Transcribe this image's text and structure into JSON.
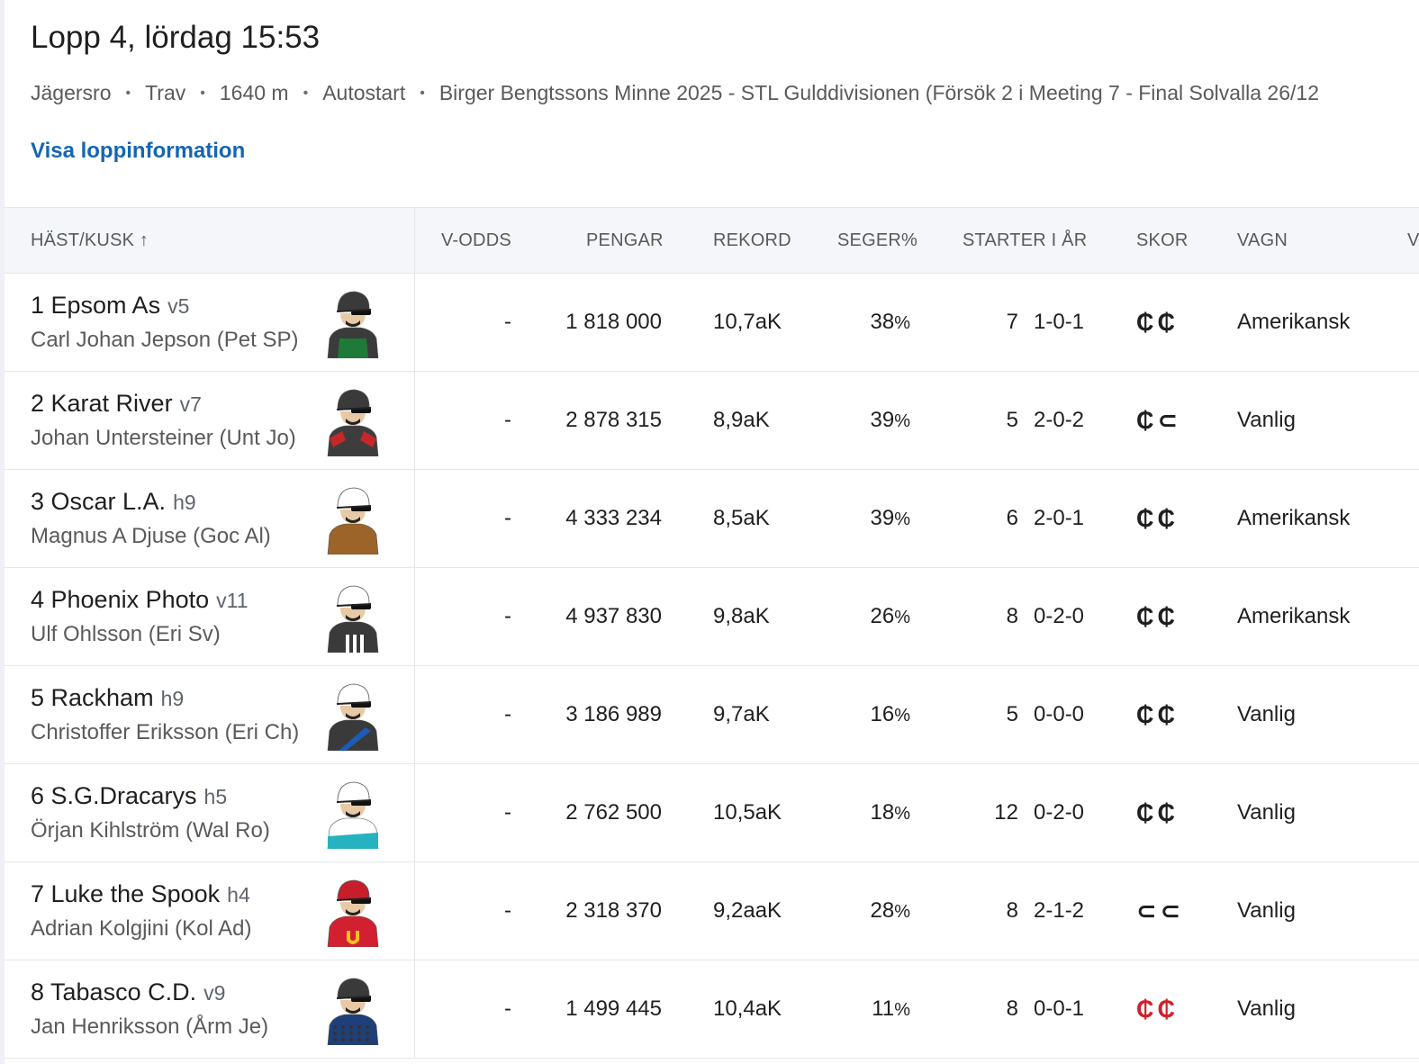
{
  "race": {
    "title": "Lopp 4,  lördag 15:53",
    "track": "Jägersro",
    "type": "Trav",
    "distance": "1640 m",
    "start": "Autostart",
    "name": "Birger Bengtssons Minne 2025 - STL Gulddivisionen (Försök 2 i Meeting 7 - Final Solvalla 26/12",
    "separator": "•",
    "info_link": "Visa loppinformation"
  },
  "columns": {
    "horse_driver": "HÄST/KUSK ↑",
    "vodds": "V-ODDS",
    "money": "PENGAR",
    "record": "REKORD",
    "win_pct": "SEGER%",
    "starts": "STARTER I ÅR",
    "shoes": "SKOR",
    "sulky": "VAGN",
    "more": "V"
  },
  "colors": {
    "link": "#1565b4",
    "shoe_red": "#d0202a",
    "header_bg": "#f4f6f9"
  },
  "rows": [
    {
      "horse": "1 Epsom As",
      "age": "v5",
      "driver": "Carl Johan Jepson (Pet SP)",
      "vodds": "-",
      "money": "1 818 000",
      "record": "10,7aK",
      "win": "38",
      "pct_sign": "%",
      "starts": "7",
      "placings": "1-0-1",
      "shoes": "₵₵",
      "shoes_red": false,
      "sulky": "Amerikansk",
      "silk": {
        "helmet": "#3a3a3a",
        "body": "#3b3b3b",
        "accent": "#1f7a3a",
        "pattern": "vest"
      }
    },
    {
      "horse": "2 Karat River",
      "age": "v7",
      "driver": "Johan Untersteiner (Unt Jo)",
      "vodds": "-",
      "money": "2 878 315",
      "record": "8,9aK",
      "win": "39",
      "pct_sign": "%",
      "starts": "5",
      "placings": "2-0-2",
      "shoes": "₵⊂",
      "shoes_red": false,
      "sulky": "Vanlig",
      "silk": {
        "helmet": "#3a3a3a",
        "body": "#3d3d3d",
        "accent": "#c62828",
        "pattern": "shoulders"
      }
    },
    {
      "horse": "3 Oscar L.A.",
      "age": "h9",
      "driver": "Magnus A Djuse (Goc Al)",
      "vodds": "-",
      "money": "4 333 234",
      "record": "8,5aK",
      "win": "39",
      "pct_sign": "%",
      "starts": "6",
      "placings": "2-0-1",
      "shoes": "₵₵",
      "shoes_red": false,
      "sulky": "Amerikansk",
      "silk": {
        "helmet": "#ffffff",
        "body": "#9c6428",
        "accent": "#9c6428",
        "pattern": "plain"
      }
    },
    {
      "horse": "4 Phoenix Photo",
      "age": "v11",
      "driver": "Ulf Ohlsson (Eri Sv)",
      "vodds": "-",
      "money": "4 937 830",
      "record": "9,8aK",
      "win": "26",
      "pct_sign": "%",
      "starts": "8",
      "placings": "0-2-0",
      "shoes": "₵₵",
      "shoes_red": false,
      "sulky": "Amerikansk",
      "silk": {
        "helmet": "#ffffff",
        "body": "#3a3a3a",
        "accent": "#ffffff",
        "pattern": "stripes"
      }
    },
    {
      "horse": "5 Rackham",
      "age": "h9",
      "driver": "Christoffer Eriksson (Eri Ch)",
      "vodds": "-",
      "money": "3 186 989",
      "record": "9,7aK",
      "win": "16",
      "pct_sign": "%",
      "starts": "5",
      "placings": "0-0-0",
      "shoes": "₵₵",
      "shoes_red": false,
      "sulky": "Vanlig",
      "silk": {
        "helmet": "#ffffff",
        "body": "#3a3a3a",
        "accent": "#1e5bb8",
        "pattern": "sash"
      }
    },
    {
      "horse": "6 S.G.Dracarys",
      "age": "h5",
      "driver": "Örjan Kihlström (Wal Ro)",
      "vodds": "-",
      "money": "2 762 500",
      "record": "10,5aK",
      "win": "18",
      "pct_sign": "%",
      "starts": "12",
      "placings": "0-2-0",
      "shoes": "₵₵",
      "shoes_red": false,
      "sulky": "Vanlig",
      "silk": {
        "helmet": "#ffffff",
        "body": "#ffffff",
        "accent": "#26b3c0",
        "pattern": "lower"
      }
    },
    {
      "horse": "7 Luke the Spook",
      "age": "h4",
      "driver": "Adrian Kolgjini (Kol Ad)",
      "vodds": "-",
      "money": "2 318 370",
      "record": "9,2aaK",
      "win": "28",
      "pct_sign": "%",
      "starts": "8",
      "placings": "2-1-2",
      "shoes": "⊂⊂",
      "shoes_red": false,
      "sulky": "Vanlig",
      "silk": {
        "helmet": "#c81e2a",
        "body": "#d32030",
        "accent": "#f2c21b",
        "pattern": "horseshoe"
      }
    },
    {
      "horse": "8 Tabasco C.D.",
      "age": "v9",
      "driver": "Jan Henriksson (Årm Je)",
      "vodds": "-",
      "money": "1 499 445",
      "record": "10,4aK",
      "win": "11",
      "pct_sign": "%",
      "starts": "8",
      "placings": "0-0-1",
      "shoes": "₵₵",
      "shoes_red": true,
      "sulky": "Vanlig",
      "silk": {
        "helmet": "#3a3a3a",
        "body": "#1e3f7a",
        "accent": "#333333",
        "pattern": "dots"
      }
    }
  ]
}
